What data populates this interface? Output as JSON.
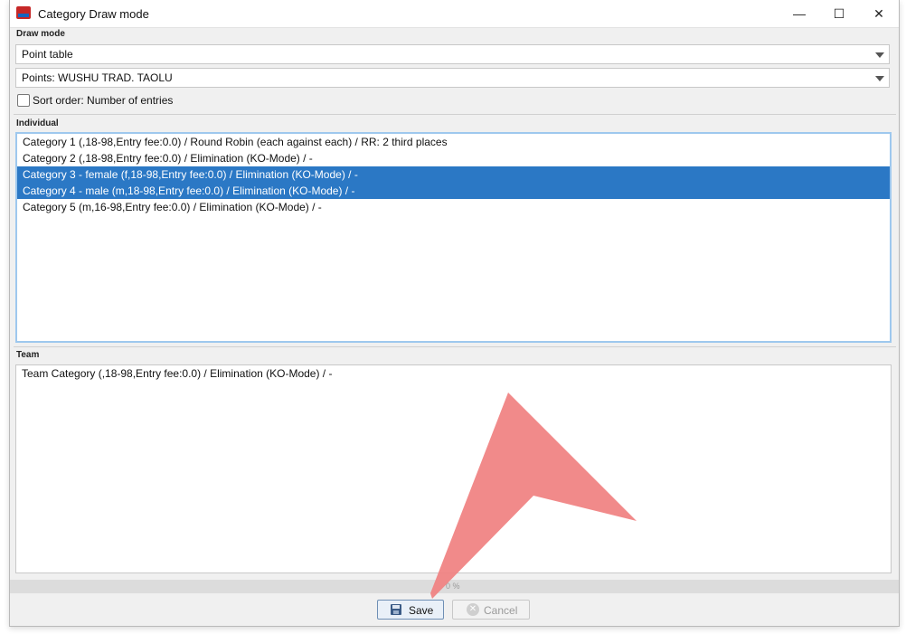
{
  "window": {
    "title": "Category Draw mode",
    "controls": {
      "minimize": "—",
      "maximize": "☐",
      "close": "✕"
    }
  },
  "draw_mode": {
    "section_label": "Draw mode",
    "mode_select": {
      "value": "Point table"
    },
    "points_select": {
      "value": "Points: WUSHU TRAD. TAOLU"
    },
    "sort_checkbox": {
      "label": "Sort order: Number of entries",
      "checked": false
    }
  },
  "individual": {
    "section_label": "Individual",
    "rows": [
      {
        "text": "Category 1 (,18-98,Entry fee:0.0) / Round Robin (each against each) / RR: 2 third places",
        "selected": false
      },
      {
        "text": "Category 2 (,18-98,Entry fee:0.0) / Elimination (KO-Mode) / -",
        "selected": false
      },
      {
        "text": "Category 3 - female (f,18-98,Entry fee:0.0) / Elimination (KO-Mode) / -",
        "selected": true
      },
      {
        "text": "Category 4 - male (m,18-98,Entry fee:0.0) / Elimination (KO-Mode) / -",
        "selected": true
      },
      {
        "text": "Category 5 (m,16-98,Entry fee:0.0) / Elimination (KO-Mode) / -",
        "selected": false
      }
    ]
  },
  "team": {
    "section_label": "Team",
    "rows": [
      {
        "text": "Team Category (,18-98,Entry fee:0.0) / Elimination (KO-Mode) / -",
        "selected": false
      }
    ]
  },
  "progress": {
    "text": "0 %",
    "value": 0
  },
  "buttons": {
    "save": "Save",
    "cancel": "Cancel"
  },
  "colors": {
    "selection": "#2b78c5",
    "overlay_arrow": "#f08080"
  }
}
